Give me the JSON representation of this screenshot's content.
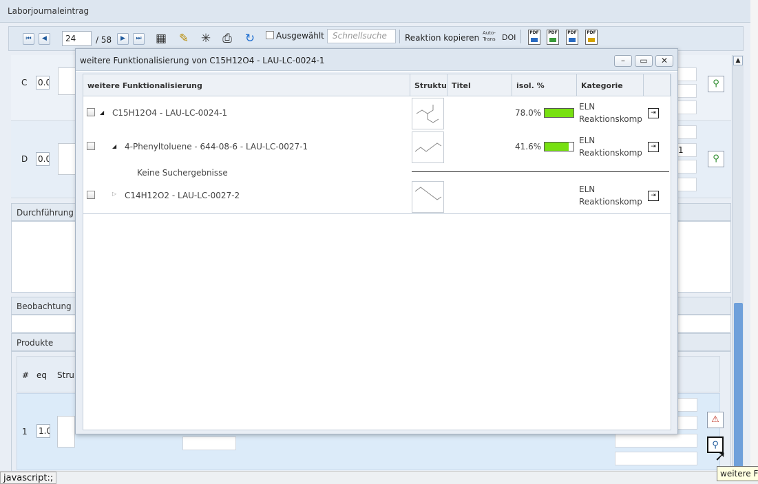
{
  "app": {
    "title": "Laborjournaleintrag"
  },
  "toolbar": {
    "page_value": "24",
    "page_total": "/ 58",
    "selected_label": "Ausgewählt",
    "quicksearch_placeholder": "Schnellsuche",
    "copy_reaction": "Reaktion kopieren",
    "autotrans_line1": "Auto-",
    "autotrans_line2": "Trans",
    "doi": "DOI",
    "pdf_label": "PDF"
  },
  "background": {
    "reactants": [
      {
        "letter": "C",
        "eq": "0.0"
      },
      {
        "letter": "D",
        "eq": "0.0"
      }
    ],
    "sections": {
      "durchfuehrung": "Durchführung",
      "beobachtung": "Beobachtung",
      "produkte": "Produkte"
    },
    "products_header": {
      "num": "#",
      "eq": "eq",
      "struct": "Stru"
    },
    "product_row": {
      "num": "1",
      "eq": "1.0"
    },
    "faded_row_value": "1"
  },
  "dialog": {
    "title": "weitere Funktionalisierung von C15H12O4 - LAU-LC-0024-1",
    "columns": [
      "weitere Funktionalisierung",
      "Struktur",
      "Titel",
      "isol. %",
      "Kategorie"
    ],
    "rows": [
      {
        "label": "C15H12O4 - LAU-LC-0024-1",
        "yield_text": "78.0%",
        "yield": 78.0,
        "category_line1": "ELN",
        "category_line2": "Reaktionskomp"
      },
      {
        "label": "4-Phenyltoluene - 644-08-6 - LAU-LC-0027-1",
        "yield_text": "41.6%",
        "yield": 41.6,
        "category_line1": "ELN",
        "category_line2": "Reaktionskomp"
      },
      {
        "label": "C14H12O2 - LAU-LC-0027-2",
        "yield_text": "",
        "category_line1": "ELN",
        "category_line2": "Reaktionskomp"
      }
    ],
    "no_results": "Keine Suchergebnisse"
  },
  "status_bar": {
    "text": "javascript:;"
  },
  "tooltip": {
    "text": "weitere F"
  },
  "colors": {
    "yield_bar": "#77e011",
    "panel_bg": "#e9eef5",
    "header_bg": "#dde6f0"
  }
}
